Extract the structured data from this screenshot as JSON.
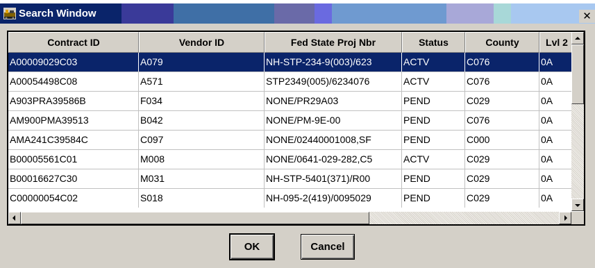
{
  "window": {
    "title": "Search Window",
    "close_glyph": "✕"
  },
  "grid": {
    "columns": [
      "Contract ID",
      "Vendor ID",
      "Fed State Proj Nbr",
      "Status",
      "County",
      "Lvl 2"
    ],
    "rows": [
      [
        "A00009029C03",
        "A079",
        "NH-STP-234-9(003)/623",
        "ACTV",
        "C076",
        "0A"
      ],
      [
        "A00054498C08",
        "A571",
        "STP2349(005)/6234076",
        "ACTV",
        "C076",
        "0A"
      ],
      [
        "A903PRA39586B",
        "F034",
        "NONE/PR29A03",
        "PEND",
        "C029",
        "0A"
      ],
      [
        "AM900PMA39513",
        "B042",
        "NONE/PM-9E-00",
        "PEND",
        "C076",
        "0A"
      ],
      [
        "AMA241C39584C",
        "C097",
        "NONE/02440001008,SF",
        "PEND",
        "C000",
        "0A"
      ],
      [
        "B00005561C01",
        "M008",
        "NONE/0641-029-282,C5",
        "ACTV",
        "C029",
        "0A"
      ],
      [
        "B00016627C30",
        "M031",
        "NH-STP-5401(371)/R00",
        "PEND",
        "C029",
        "0A"
      ],
      [
        "C00000054C02",
        "S018",
        "NH-095-2(419)/0095029",
        "PEND",
        "C029",
        "0A"
      ]
    ],
    "selected_row": 0
  },
  "buttons": {
    "ok_label": "OK",
    "cancel_label": "Cancel"
  },
  "colors": {
    "title_bar": "#0a246a",
    "selection": "#0a246a",
    "face": "#d4d0c8"
  }
}
